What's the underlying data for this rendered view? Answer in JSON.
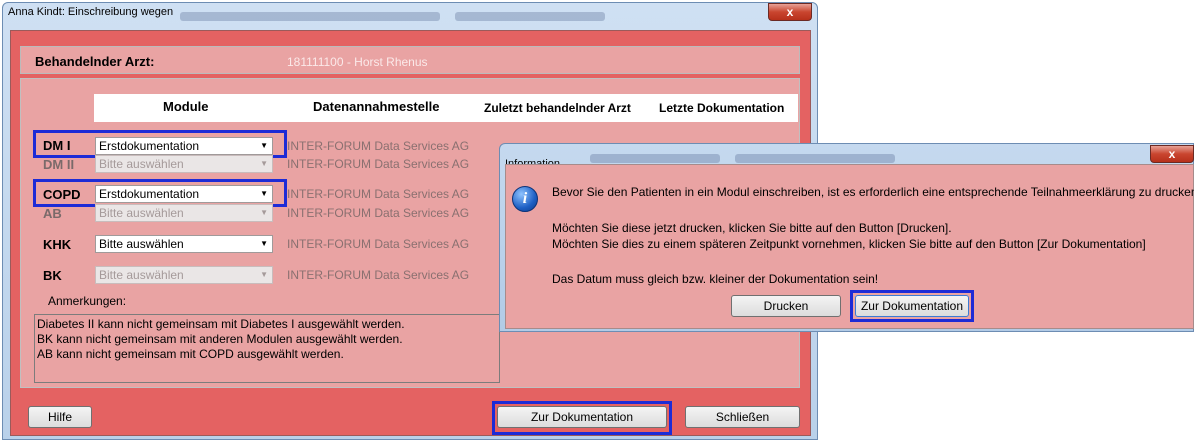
{
  "main_window": {
    "title": "Anna Kindt: Einschreibung wegen",
    "header_label": "Behandelnder Arzt:",
    "doctor_value": "181111100 - Horst Rhenus",
    "close_glyph": "x"
  },
  "table": {
    "headers": {
      "module": "Module",
      "annahmestelle": "Datenannahmestelle",
      "zuletzt": "Zuletzt behandelnder Arzt",
      "letzte": "Letzte Dokumentation"
    },
    "rows": [
      {
        "label": "DM I",
        "select": "Erstdokumentation",
        "service": "INTER-FORUM Data Services AG"
      },
      {
        "label": "DM II",
        "select": "Bitte auswählen",
        "service": "INTER-FORUM Data Services AG"
      },
      {
        "label": "COPD",
        "select": "Erstdokumentation",
        "service": "INTER-FORUM Data Services AG"
      },
      {
        "label": "AB",
        "select": "Bitte auswählen",
        "service": "INTER-FORUM Data Services AG"
      },
      {
        "label": "KHK",
        "select": "Bitte auswählen",
        "service": "INTER-FORUM Data Services AG"
      },
      {
        "label": "BK",
        "select": "Bitte auswählen",
        "service": "INTER-FORUM Data Services AG"
      }
    ]
  },
  "notes": {
    "label": "Anmerkungen:",
    "lines": [
      "Diabetes II kann nicht gemeinsam mit Diabetes I ausgewählt werden.",
      "BK kann nicht gemeinsam mit anderen Modulen ausgewählt werden.",
      "AB kann nicht gemeinsam mit COPD ausgewählt werden."
    ]
  },
  "buttons": {
    "help": "Hilfe",
    "zur_doku": "Zur Dokumentation",
    "close": "Schließen"
  },
  "dialog": {
    "title": "Information",
    "message1": "Bevor Sie den Patienten in ein Modul einschreiben, ist es erforderlich eine entsprechende Teilnahmeerklärung zu drucken.",
    "message2": "Möchten Sie diese jetzt drucken, klicken Sie bitte auf den Button [Drucken].",
    "message3": "Möchten Sie dies zu einem späteren Zeitpunkt vornehmen, klicken Sie bitte auf den Button [Zur Dokumentation]",
    "message4": "Das Datum muss gleich bzw. kleiner der Dokumentation sein!",
    "print_button": "Drucken",
    "doku_button": "Zur Dokumentation",
    "close_glyph": "x"
  },
  "colors": {
    "window_bg": "#e46262",
    "form_bg": "#e9a3a3",
    "highlight": "#1d2bd6"
  }
}
